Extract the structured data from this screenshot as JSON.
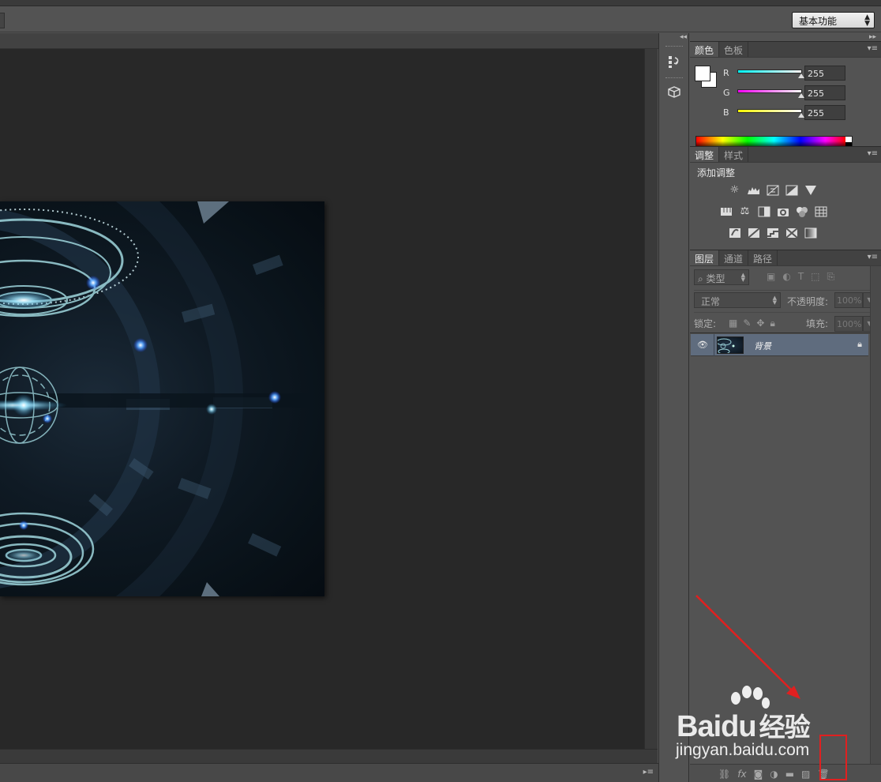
{
  "options_bar": {
    "workspace": "基本功能"
  },
  "colors": {
    "accent_blue": "#5f6c7e",
    "annotation_red": "#e02020"
  },
  "color_panel": {
    "tabs": [
      "颜色",
      "色板"
    ],
    "channels": [
      {
        "label": "R",
        "value": "255"
      },
      {
        "label": "G",
        "value": "255"
      },
      {
        "label": "B",
        "value": "255"
      }
    ]
  },
  "adjustments_panel": {
    "tabs": [
      "调整",
      "样式"
    ],
    "title": "添加调整",
    "rows": [
      [
        "brightness-contrast-icon",
        "levels-icon",
        "curves-icon",
        "exposure-icon",
        "vibrance-icon"
      ],
      [
        "hue-saturation-icon",
        "color-balance-icon",
        "black-white-icon",
        "photo-filter-icon",
        "channel-mixer-icon",
        "color-lookup-icon"
      ],
      [
        "invert-icon",
        "posterize-icon",
        "threshold-icon",
        "selective-color-icon",
        "gradient-map-icon"
      ]
    ]
  },
  "layers_panel": {
    "tabs": [
      "图层",
      "通道",
      "路径"
    ],
    "filter_kind": "类型",
    "blend_mode": "正常",
    "opacity_label": "不透明度:",
    "opacity_value": "100%",
    "lock_label": "锁定:",
    "fill_label": "填充:",
    "fill_value": "100%",
    "layers": [
      {
        "name": "背景",
        "visible": true,
        "locked": true
      }
    ],
    "footer_icons": [
      "link-layers-icon",
      "fx-icon",
      "add-mask-icon",
      "adjustment-layer-icon",
      "new-group-icon",
      "new-layer-icon",
      "delete-layer-icon"
    ]
  },
  "watermark": {
    "brand": "Bai",
    "brand_paw": "du",
    "brand_cn": "经验",
    "url": "jingyan.baidu.com"
  }
}
